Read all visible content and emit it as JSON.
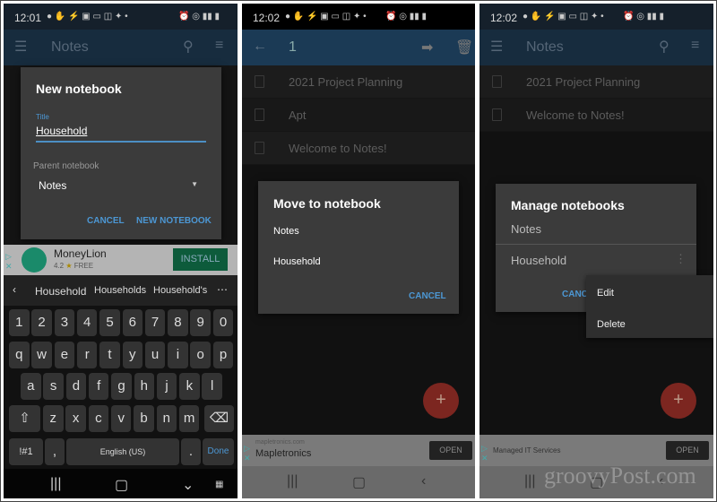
{
  "panels": [
    {
      "time": "12:01",
      "app_title": "Notes",
      "dialog": {
        "title": "New notebook",
        "field_label": "Title",
        "field_value": "Household",
        "parent_label": "Parent notebook",
        "parent_value": "Notes",
        "cancel": "CANCEL",
        "confirm": "NEW NOTEBOOK"
      },
      "ad": {
        "name": "MoneyLion",
        "rating": "4.2",
        "rating_star": "★",
        "price": "FREE",
        "install": "INSTALL"
      },
      "suggestions": [
        "Household",
        "Households",
        "Household's"
      ],
      "keyboard": {
        "numbers": [
          "1",
          "2",
          "3",
          "4",
          "5",
          "6",
          "7",
          "8",
          "9",
          "0"
        ],
        "row1": [
          "q",
          "w",
          "e",
          "r",
          "t",
          "y",
          "u",
          "i",
          "o",
          "p"
        ],
        "row2": [
          "a",
          "s",
          "d",
          "f",
          "g",
          "h",
          "j",
          "k",
          "l"
        ],
        "row3": [
          "z",
          "x",
          "c",
          "v",
          "b",
          "n",
          "m"
        ],
        "symbols": "!#1",
        "comma": ",",
        "space": "English (US)",
        "period": ".",
        "done": "Done"
      }
    },
    {
      "time": "12:02",
      "app_title": "1",
      "notes": [
        "2021 Project Planning",
        "Apt",
        "Welcome to Notes!"
      ],
      "dialog": {
        "title": "Move to notebook",
        "options": [
          "Notes",
          "Household"
        ],
        "cancel": "CANCEL"
      },
      "ad": {
        "domain": "mapletronics.com",
        "name": "Mapletronics",
        "open": "OPEN"
      }
    },
    {
      "time": "12:02",
      "app_title": "Notes",
      "notes": [
        "2021 Project Planning",
        "Welcome to Notes!"
      ],
      "dialog": {
        "title": "Manage notebooks",
        "items": [
          "Notes",
          "Household"
        ],
        "cancel": "CANC"
      },
      "menu": [
        "Edit",
        "Delete"
      ],
      "ad": {
        "name": "Managed IT Services",
        "open": "OPEN"
      }
    }
  ],
  "watermark": "groovyPost.com",
  "colors": {
    "accent": "#4c97d4",
    "fab": "#7c2620",
    "appbar": "#1b3a55"
  }
}
